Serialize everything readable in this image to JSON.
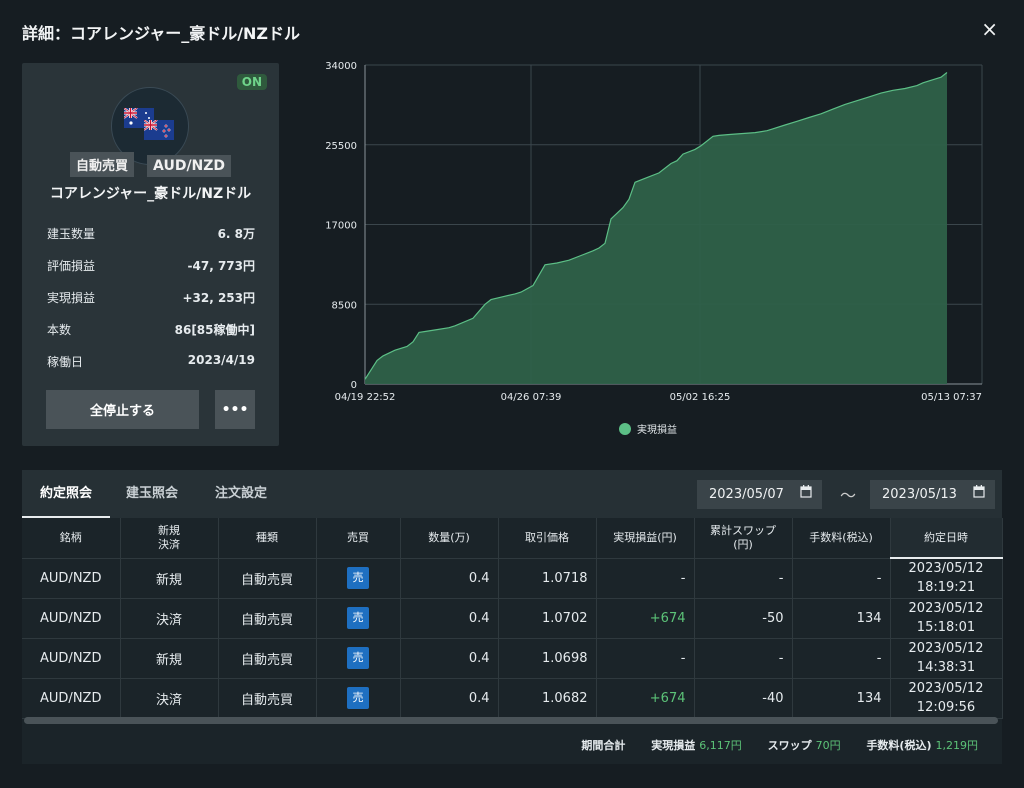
{
  "dialog": {
    "title": "詳細：コアレンジャー_豪ドル/NZドル",
    "close_icon": "×"
  },
  "card": {
    "status_badge": "ON",
    "flag_icons": [
      "australia-flag-icon",
      "new-zealand-flag-icon"
    ],
    "tag_type": "自動売買",
    "tag_pair": "AUD/NZD",
    "name": "コアレンジャー_豪ドル/NZドル",
    "stats": [
      {
        "label": "建玉数量",
        "value": "6. 8万"
      },
      {
        "label": "評価損益",
        "value": "-47, 773円"
      },
      {
        "label": "実現損益",
        "value": "+32, 253円"
      },
      {
        "label": "本数",
        "value": "86[85稼働中]"
      },
      {
        "label": "稼働日",
        "value": "2023/4/19"
      }
    ],
    "stop_button": "全停止する",
    "more_button": "•••"
  },
  "chart_data": {
    "type": "area",
    "x_tick_labels": [
      "04/19 22:52",
      "04/26 07:39",
      "05/02 16:25",
      "05/13 07:37"
    ],
    "y_ticks": [
      0,
      8500,
      17000,
      25500,
      34000
    ],
    "ylim": [
      0,
      34000
    ],
    "series": [
      {
        "name": "実現損益",
        "color": "#5cbf86",
        "x": [
          0,
          1,
          2,
          3,
          5,
          7,
          8,
          9,
          10,
          12,
          14,
          15,
          18,
          20,
          21,
          23,
          25,
          26,
          28,
          30,
          32,
          34,
          36,
          38,
          39,
          40,
          41,
          43,
          44,
          45,
          47,
          49,
          51,
          52,
          53,
          55,
          56,
          58,
          59,
          61,
          63,
          65,
          67,
          68,
          70,
          72,
          74,
          76,
          78,
          80,
          82,
          84,
          86,
          88,
          90,
          92,
          93,
          95,
          96,
          97
        ],
        "y": [
          500,
          1500,
          2500,
          3000,
          3600,
          4000,
          4500,
          5500,
          5600,
          5800,
          6000,
          6200,
          7000,
          8500,
          9000,
          9300,
          9600,
          9800,
          10500,
          12700,
          12900,
          13200,
          13700,
          14200,
          14500,
          15000,
          17600,
          18800,
          19700,
          21500,
          22000,
          22500,
          23500,
          23800,
          24500,
          25000,
          25400,
          26400,
          26500,
          26600,
          26700,
          26800,
          27000,
          27200,
          27600,
          28000,
          28400,
          28800,
          29300,
          29800,
          30200,
          30600,
          31000,
          31300,
          31500,
          31800,
          32100,
          32500,
          32700,
          33200
        ]
      }
    ],
    "legend": "bottom",
    "grid": true
  },
  "tabs": [
    "約定照会",
    "建玉照会",
    "注文設定"
  ],
  "date_from": "2023/05/07",
  "date_to": "2023/05/13",
  "date_separator": "〜",
  "calendar_icon": "calendar-icon",
  "table": {
    "columns": [
      "銘柄",
      "新規\n決済",
      "種類",
      "売買",
      "数量(万)",
      "取引価格",
      "実現損益(円)",
      "累計スワップ\n(円)",
      "手数料(税込)",
      "約定日時"
    ],
    "rows": [
      {
        "pair": "AUD/NZD",
        "kind": "新規",
        "type": "自動売買",
        "side": "売",
        "qty": "0.4",
        "price": "1.0718",
        "pl": "-",
        "swap": "-",
        "fee": "-",
        "date": "2023/05/12",
        "time": "18:19:21"
      },
      {
        "pair": "AUD/NZD",
        "kind": "決済",
        "type": "自動売買",
        "side": "売",
        "qty": "0.4",
        "price": "1.0702",
        "pl": "+674",
        "swap": "-50",
        "fee": "134",
        "date": "2023/05/12",
        "time": "15:18:01"
      },
      {
        "pair": "AUD/NZD",
        "kind": "新規",
        "type": "自動売買",
        "side": "売",
        "qty": "0.4",
        "price": "1.0698",
        "pl": "-",
        "swap": "-",
        "fee": "-",
        "date": "2023/05/12",
        "time": "14:38:31"
      },
      {
        "pair": "AUD/NZD",
        "kind": "決済",
        "type": "自動売買",
        "side": "売",
        "qty": "0.4",
        "price": "1.0682",
        "pl": "+674",
        "swap": "-40",
        "fee": "134",
        "date": "2023/05/12",
        "time": "12:09:56"
      }
    ]
  },
  "summary": {
    "label": "期間合計",
    "pl_label": "実現損益",
    "pl_value": "6,117円",
    "swap_label": "スワップ",
    "swap_value": "70円",
    "fee_label": "手数料(税込)",
    "fee_value": "1,219円"
  }
}
